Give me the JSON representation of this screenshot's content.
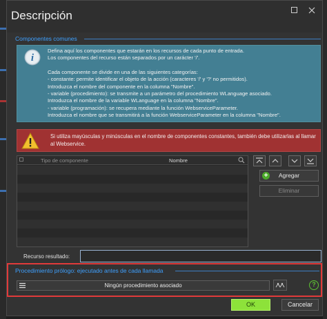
{
  "window": {
    "title": "Descripción",
    "icons": {
      "maximize": "maximize-icon",
      "close": "close-icon"
    }
  },
  "components_section": {
    "title": "Componentes comunes",
    "info": {
      "icon": "info-icon",
      "lines": [
        "Defina aquí los componentes que estarán en los recursos de cada punto de entrada.",
        "Los componentes del recurso están separados por un carácter '/'.",
        "",
        "Cada componente se divide en una de las siguientes categorías:",
        "- constante: permite identificar el objeto de la acción (caracteres '/' y '?' no permitidos).",
        "Introduzca el nombre del componente en la columna \"Nombre\".",
        "- variable (procedimiento): se transmite a un parámetro del procedimiento WLanguage asociado.",
        "Introduzca el nombre de la variable WLanguage en la columna \"Nombre\".",
        "- variable (programación): se recupera mediante la función WebserviceParameter.",
        "Introduzca el nombre que se transmitirá a la función WebserviceParameter en la columna \"Nombre\"."
      ]
    },
    "warning": {
      "icon": "warning-icon",
      "text": "Si utiliza mayúsculas y minúsculas en el nombre de componentes constantes, también debe utilizarlas al llamar al Webservice."
    },
    "table": {
      "columns": [
        "Tipo de componente",
        "Nombre"
      ],
      "search_icon": "search-icon",
      "rows": []
    },
    "move_buttons": [
      "move-top-icon",
      "move-up-icon",
      "move-down-icon",
      "move-bottom-icon"
    ],
    "add_label": "Agregar",
    "remove_label": "Eliminar"
  },
  "result": {
    "label": "Recurso resultado:",
    "value": ""
  },
  "prologue": {
    "title": "Procedimiento prólogo: ejecutado antes de cada llamada",
    "procedure_label": "Ningún procedimiento asociado",
    "icons": {
      "menu": "menu-icon",
      "link": "link-icon",
      "help": "help-icon"
    }
  },
  "footer": {
    "ok_label": "OK",
    "cancel_label": "Cancelar"
  },
  "colors": {
    "accent": "#3ea0ff",
    "info_bg": "#437f93",
    "warning_bg": "#a03232",
    "ok_bg": "#8de23a",
    "highlight": "#e23a3a"
  }
}
